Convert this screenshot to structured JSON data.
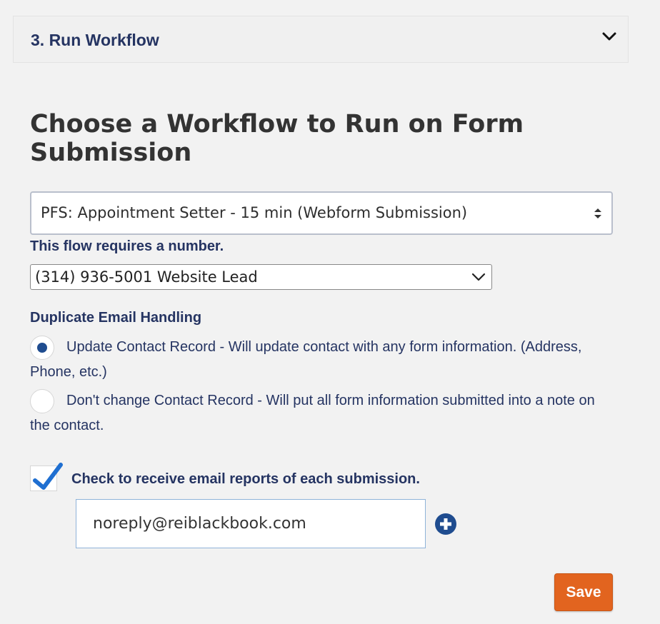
{
  "section": {
    "title": "3. Run Workflow"
  },
  "heading": "Choose a Workflow to Run on Form Submission",
  "workflow_select": {
    "value": "PFS: Appointment Setter - 15 min (Webform Submission)"
  },
  "number_requirement": {
    "label": "This flow requires a number.",
    "selected": "(314) 936-5001 Website Lead"
  },
  "duplicate_handling": {
    "label": "Duplicate Email Handling",
    "options": [
      {
        "label": "Update Contact Record - Will update contact with any form information. (Address, Phone, etc.)",
        "selected": true
      },
      {
        "label": "Don't change Contact Record - Will put all form information submitted into a note on the contact.",
        "selected": false
      }
    ]
  },
  "email_reports": {
    "checked": true,
    "label": "Check to receive email reports of each submission.",
    "email_value": "noreply@reiblackbook.com"
  },
  "actions": {
    "save_label": "Save"
  },
  "colors": {
    "accent": "#1f4c8f",
    "save": "#e2641f",
    "text": "#253462"
  }
}
